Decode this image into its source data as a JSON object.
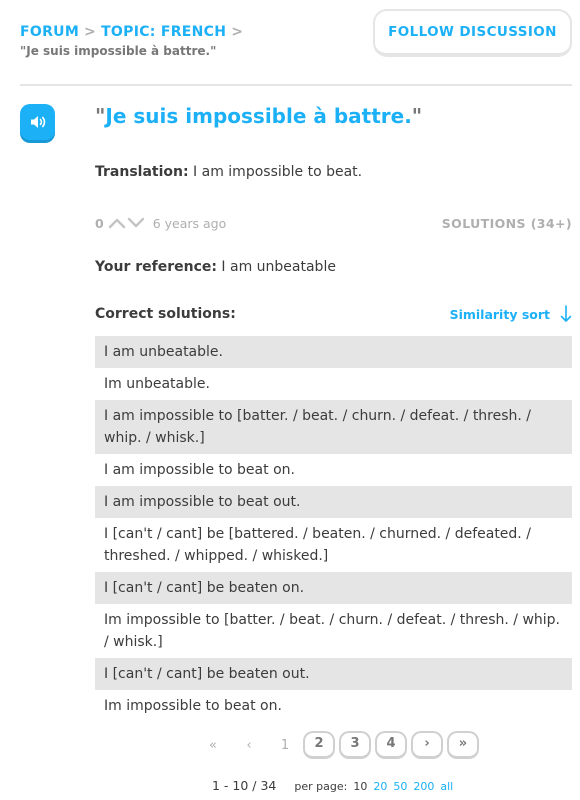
{
  "breadcrumb": {
    "forum": "FORUM",
    "separator": ">",
    "topic": "TOPIC: FRENCH",
    "current": "\"Je suis impossible à battre.\""
  },
  "follow_button": "FOLLOW DISCUSSION",
  "sentence": {
    "open_quote": "\"",
    "text": "Je suis impossible à battre.",
    "close_quote": "\""
  },
  "translation": {
    "label": "Translation:",
    "text": "I am impossible to beat."
  },
  "votes": {
    "count": "0",
    "time": "6 years ago",
    "solutions_link": "SOLUTIONS (34+)"
  },
  "reference": {
    "label": "Your reference:",
    "text": "I am unbeatable"
  },
  "correct_solutions": {
    "label": "Correct solutions:",
    "sort_label": "Similarity sort",
    "items": [
      "I am unbeatable.",
      "Im unbeatable.",
      "I am impossible to [batter. / beat. / churn. / defeat. / thresh. / whip. / whisk.]",
      "I am impossible to beat on.",
      "I am impossible to beat out.",
      "I [can't / cant] be [battered. / beaten. / churned. / defeated. / threshed. / whipped. / whisked.]",
      "I [can't / cant] be beaten on.",
      "Im impossible to [batter. / beat. / churn. / defeat. / thresh. / whip. / whisk.]",
      "I [can't / cant] be beaten out.",
      "Im impossible to beat on."
    ]
  },
  "pagination": {
    "first": "«",
    "prev": "‹",
    "pages": [
      "1",
      "2",
      "3",
      "4"
    ],
    "next": "›",
    "last": "»",
    "range": "1 - 10 / 34",
    "per_page_label": "per page:",
    "per_page_options": [
      "10",
      "20",
      "50",
      "200",
      "all"
    ]
  },
  "colors": {
    "accent": "#1cb0f6",
    "text": "#3c3c3c",
    "muted": "#afafaf",
    "stripe": "#e5e5e5"
  },
  "icons": {
    "speaker": "speaker-icon",
    "upvote": "chevron-up-icon",
    "downvote": "chevron-down-icon",
    "sort": "arrow-down-icon"
  }
}
